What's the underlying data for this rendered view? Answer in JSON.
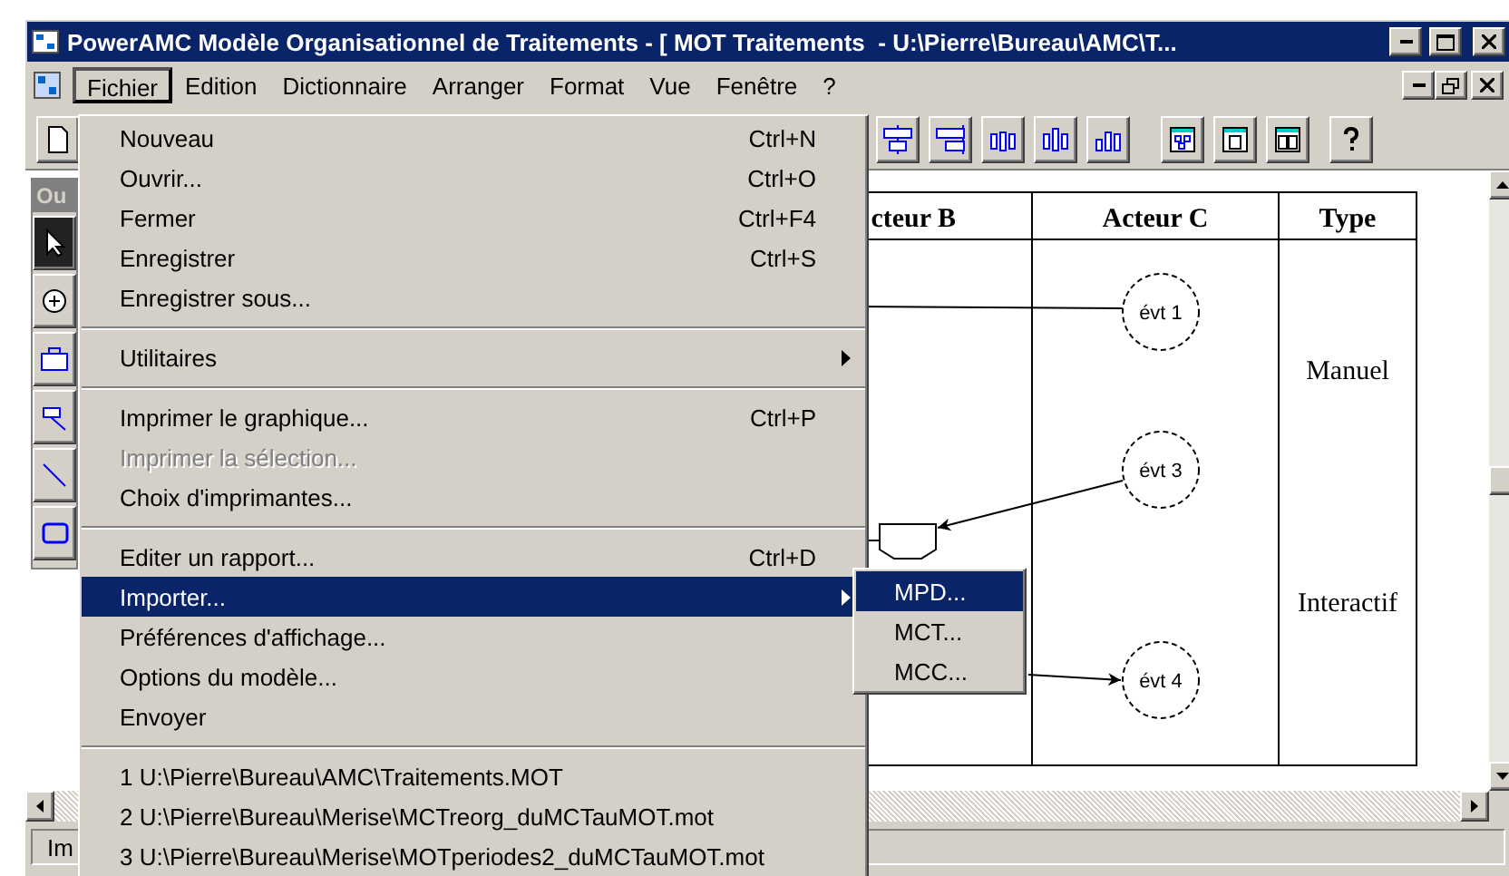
{
  "window": {
    "title": "PowerAMC Modèle Organisationnel de Traitements - [ MOT Traitements  - U:\\Pierre\\Bureau\\AMC\\T..."
  },
  "menu_bar": [
    {
      "label": "Fichier",
      "selected": true
    },
    {
      "label": "Edition",
      "selected": false
    },
    {
      "label": "Dictionnaire",
      "selected": false
    },
    {
      "label": "Arranger",
      "selected": false
    },
    {
      "label": "Format",
      "selected": false
    },
    {
      "label": "Vue",
      "selected": false
    },
    {
      "label": "Fenêtre",
      "selected": false
    },
    {
      "label": "?",
      "selected": false
    }
  ],
  "file_menu": [
    {
      "kind": "item",
      "label": "Nouveau",
      "shortcut": "Ctrl+N",
      "disabled": false,
      "selected": false,
      "submenu": false
    },
    {
      "kind": "item",
      "label": "Ouvrir...",
      "shortcut": "Ctrl+O",
      "disabled": false,
      "selected": false,
      "submenu": false
    },
    {
      "kind": "item",
      "label": "Fermer",
      "shortcut": "Ctrl+F4",
      "disabled": false,
      "selected": false,
      "submenu": false
    },
    {
      "kind": "item",
      "label": "Enregistrer",
      "shortcut": "Ctrl+S",
      "disabled": false,
      "selected": false,
      "submenu": false
    },
    {
      "kind": "item",
      "label": "Enregistrer sous...",
      "disabled": false,
      "selected": false,
      "submenu": false
    },
    {
      "kind": "separator"
    },
    {
      "kind": "item",
      "label": "Utilitaires",
      "disabled": false,
      "selected": false,
      "submenu": true
    },
    {
      "kind": "separator"
    },
    {
      "kind": "item",
      "label": "Imprimer le graphique...",
      "shortcut": "Ctrl+P",
      "disabled": false,
      "selected": false,
      "submenu": false
    },
    {
      "kind": "item",
      "label": "Imprimer la sélection...",
      "disabled": true,
      "selected": false,
      "submenu": false
    },
    {
      "kind": "item",
      "label": "Choix d'imprimantes...",
      "disabled": false,
      "selected": false,
      "submenu": false
    },
    {
      "kind": "separator"
    },
    {
      "kind": "item",
      "label": "Editer un rapport...",
      "shortcut": "Ctrl+D",
      "disabled": false,
      "selected": false,
      "submenu": false
    },
    {
      "kind": "item",
      "label": "Importer...",
      "disabled": false,
      "selected": true,
      "submenu": true
    },
    {
      "kind": "item",
      "label": "Préférences d'affichage...",
      "disabled": false,
      "selected": false,
      "submenu": false
    },
    {
      "kind": "item",
      "label": "Options du modèle...",
      "disabled": false,
      "selected": false,
      "submenu": false
    },
    {
      "kind": "item",
      "label": "Envoyer",
      "disabled": false,
      "selected": false,
      "submenu": false
    },
    {
      "kind": "separator"
    },
    {
      "kind": "item",
      "label": "1 U:\\Pierre\\Bureau\\AMC\\Traitements.MOT",
      "disabled": false,
      "selected": false,
      "submenu": false
    },
    {
      "kind": "item",
      "label": "2 U:\\Pierre\\Bureau\\Merise\\MCTreorg_duMCTauMOT.mot",
      "disabled": false,
      "selected": false,
      "submenu": false
    },
    {
      "kind": "item",
      "label": "3 U:\\Pierre\\Bureau\\Merise\\MOTperiodes2_duMCTauMOT.mot",
      "disabled": false,
      "selected": false,
      "submenu": false
    }
  ],
  "import_submenu": [
    {
      "label": "MPD...",
      "selected": true
    },
    {
      "label": "MCT...",
      "selected": false
    },
    {
      "label": "MCC...",
      "selected": false
    }
  ],
  "palette": {
    "title": "Ou"
  },
  "diagram": {
    "columns": [
      "cteur B",
      "Acteur C",
      "Type"
    ],
    "types": [
      "Manuel",
      "Interactif"
    ],
    "events": [
      "évt 1",
      "évt 3",
      "évt 4"
    ]
  },
  "status_bar": {
    "text": "Im"
  }
}
